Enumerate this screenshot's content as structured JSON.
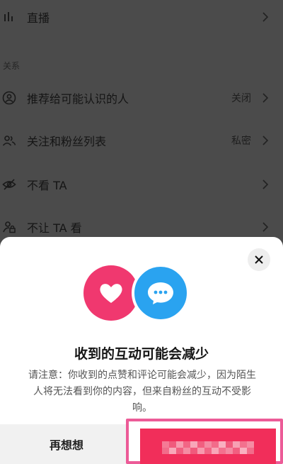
{
  "settings": {
    "live_label": "直播",
    "section_relations": "关系",
    "items": [
      {
        "label": "推荐给可能认识的人",
        "value": "关闭"
      },
      {
        "label": "关注和粉丝列表",
        "value": "私密"
      },
      {
        "label": "不看 TA",
        "value": ""
      },
      {
        "label": "不让 TA 看",
        "value": ""
      }
    ]
  },
  "dialog": {
    "title": "收到的互动可能会减少",
    "body_line1": "请注意：你收到的点赞和评论可能会减少，因为陌生",
    "body_line2": "人将无法看到你的内容，但来自粉丝的互动不受影",
    "body_line3": "响。",
    "rethink_label": "再想想",
    "confirm_label_note": "pixelated/blurred"
  },
  "icons": {
    "live": "bar-chart-icon",
    "recommend": "user-circle-icon",
    "follow": "users-icon",
    "hide": "eye-off-icon",
    "block": "user-lock-icon",
    "close": "close-icon",
    "heart": "heart-icon",
    "chat": "chat-bubble-icon"
  },
  "colors": {
    "accent": "#f12e5a",
    "heart_bg": "#f0386f",
    "chat_bg": "#2aa3f0",
    "highlight": "#ec5b97"
  }
}
